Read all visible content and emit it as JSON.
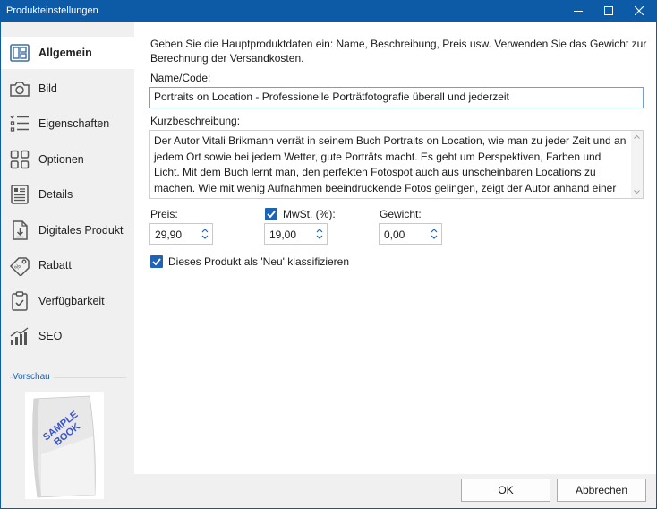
{
  "window": {
    "title": "Produkteinstellungen"
  },
  "sidebar": {
    "items": [
      {
        "label": "Allgemein",
        "icon": "layout-icon",
        "active": true
      },
      {
        "label": "Bild",
        "icon": "camera-icon"
      },
      {
        "label": "Eigenschaften",
        "icon": "list-icon"
      },
      {
        "label": "Optionen",
        "icon": "grid-icon"
      },
      {
        "label": "Details",
        "icon": "details-icon"
      },
      {
        "label": "Digitales Produkt",
        "icon": "download-file-icon"
      },
      {
        "label": "Rabatt",
        "icon": "tag-icon"
      },
      {
        "label": "Verfügbarkeit",
        "icon": "clipboard-check-icon"
      },
      {
        "label": "SEO",
        "icon": "bar-chart-icon"
      }
    ],
    "preview_label": "Vorschau",
    "preview_image_text": "SAMPLE BOOK"
  },
  "main": {
    "intro_text": "Geben Sie die Hauptproduktdaten ein: Name, Beschreibung, Preis usw. Verwenden Sie das Gewicht zur Berechnung der Versandkosten.",
    "name_label": "Name/Code:",
    "name_value": "Portraits on Location - Professionelle Porträtfotografie überall und jederzeit",
    "short_desc_label": "Kurzbeschreibung:",
    "short_desc_value": "Der Autor Vitali Brikmann verrät in seinem Buch Portraits on Location, wie man zu jeder Zeit und an jedem Ort sowie bei jedem Wetter, gute Porträts macht. Es geht um Perspektiven, Farben und Licht. Mit dem Buch lernt man, den perfekten Fotospot auch aus unscheinbaren Locations zu machen. Wie mit wenig Aufnahmen beeindruckende Fotos gelingen, zeigt der Autor anhand einer Vielzahl an Shootings.",
    "price_label": "Preis:",
    "price_value": "29,90",
    "vat_label": "MwSt. (%):",
    "vat_checked": true,
    "vat_value": "19,00",
    "weight_label": "Gewicht:",
    "weight_value": "0,00",
    "new_label": "Dieses Produkt als 'Neu' klassifizieren",
    "new_checked": true
  },
  "footer": {
    "ok_label": "OK",
    "cancel_label": "Abbrechen"
  },
  "colors": {
    "titlebar": "#0d5aa7",
    "accent": "#1f63b6",
    "sidebar_bg": "#f0f0f0"
  }
}
